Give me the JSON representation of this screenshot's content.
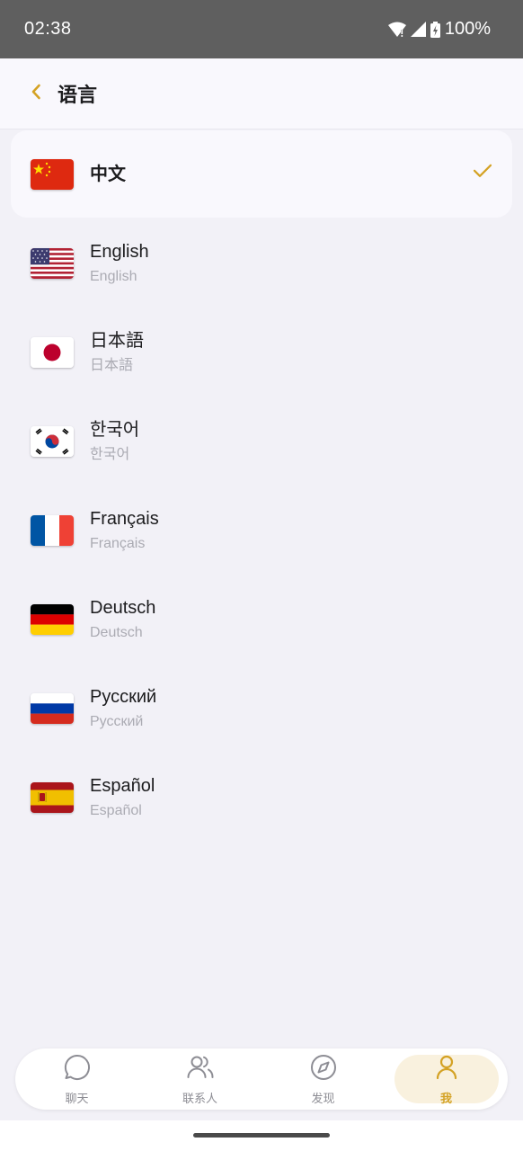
{
  "status_bar": {
    "time": "02:38",
    "battery": "100%"
  },
  "header": {
    "title": "语言",
    "accent_color": "#d4a224"
  },
  "languages": [
    {
      "name": "中文",
      "native": "",
      "flag": "cn-flag",
      "selected": true
    },
    {
      "name": "English",
      "native": "English",
      "flag": "us-flag",
      "selected": false
    },
    {
      "name": "日本語",
      "native": "日本語",
      "flag": "jp-flag",
      "selected": false
    },
    {
      "name": "한국어",
      "native": "한국어",
      "flag": "kr-flag",
      "selected": false
    },
    {
      "name": "Français",
      "native": "Français",
      "flag": "fr-flag",
      "selected": false
    },
    {
      "name": "Deutsch",
      "native": "Deutsch",
      "flag": "de-flag",
      "selected": false
    },
    {
      "name": "Русский",
      "native": "Русский",
      "flag": "ru-flag",
      "selected": false
    },
    {
      "name": "Español",
      "native": "Español",
      "flag": "es-flag",
      "selected": false
    }
  ],
  "bottom_nav": {
    "items": [
      {
        "label": "聊天",
        "icon": "chat-icon",
        "active": false
      },
      {
        "label": "联系人",
        "icon": "contacts-icon",
        "active": false
      },
      {
        "label": "发现",
        "icon": "compass-icon",
        "active": false
      },
      {
        "label": "我",
        "icon": "profile-icon",
        "active": true
      }
    ]
  }
}
